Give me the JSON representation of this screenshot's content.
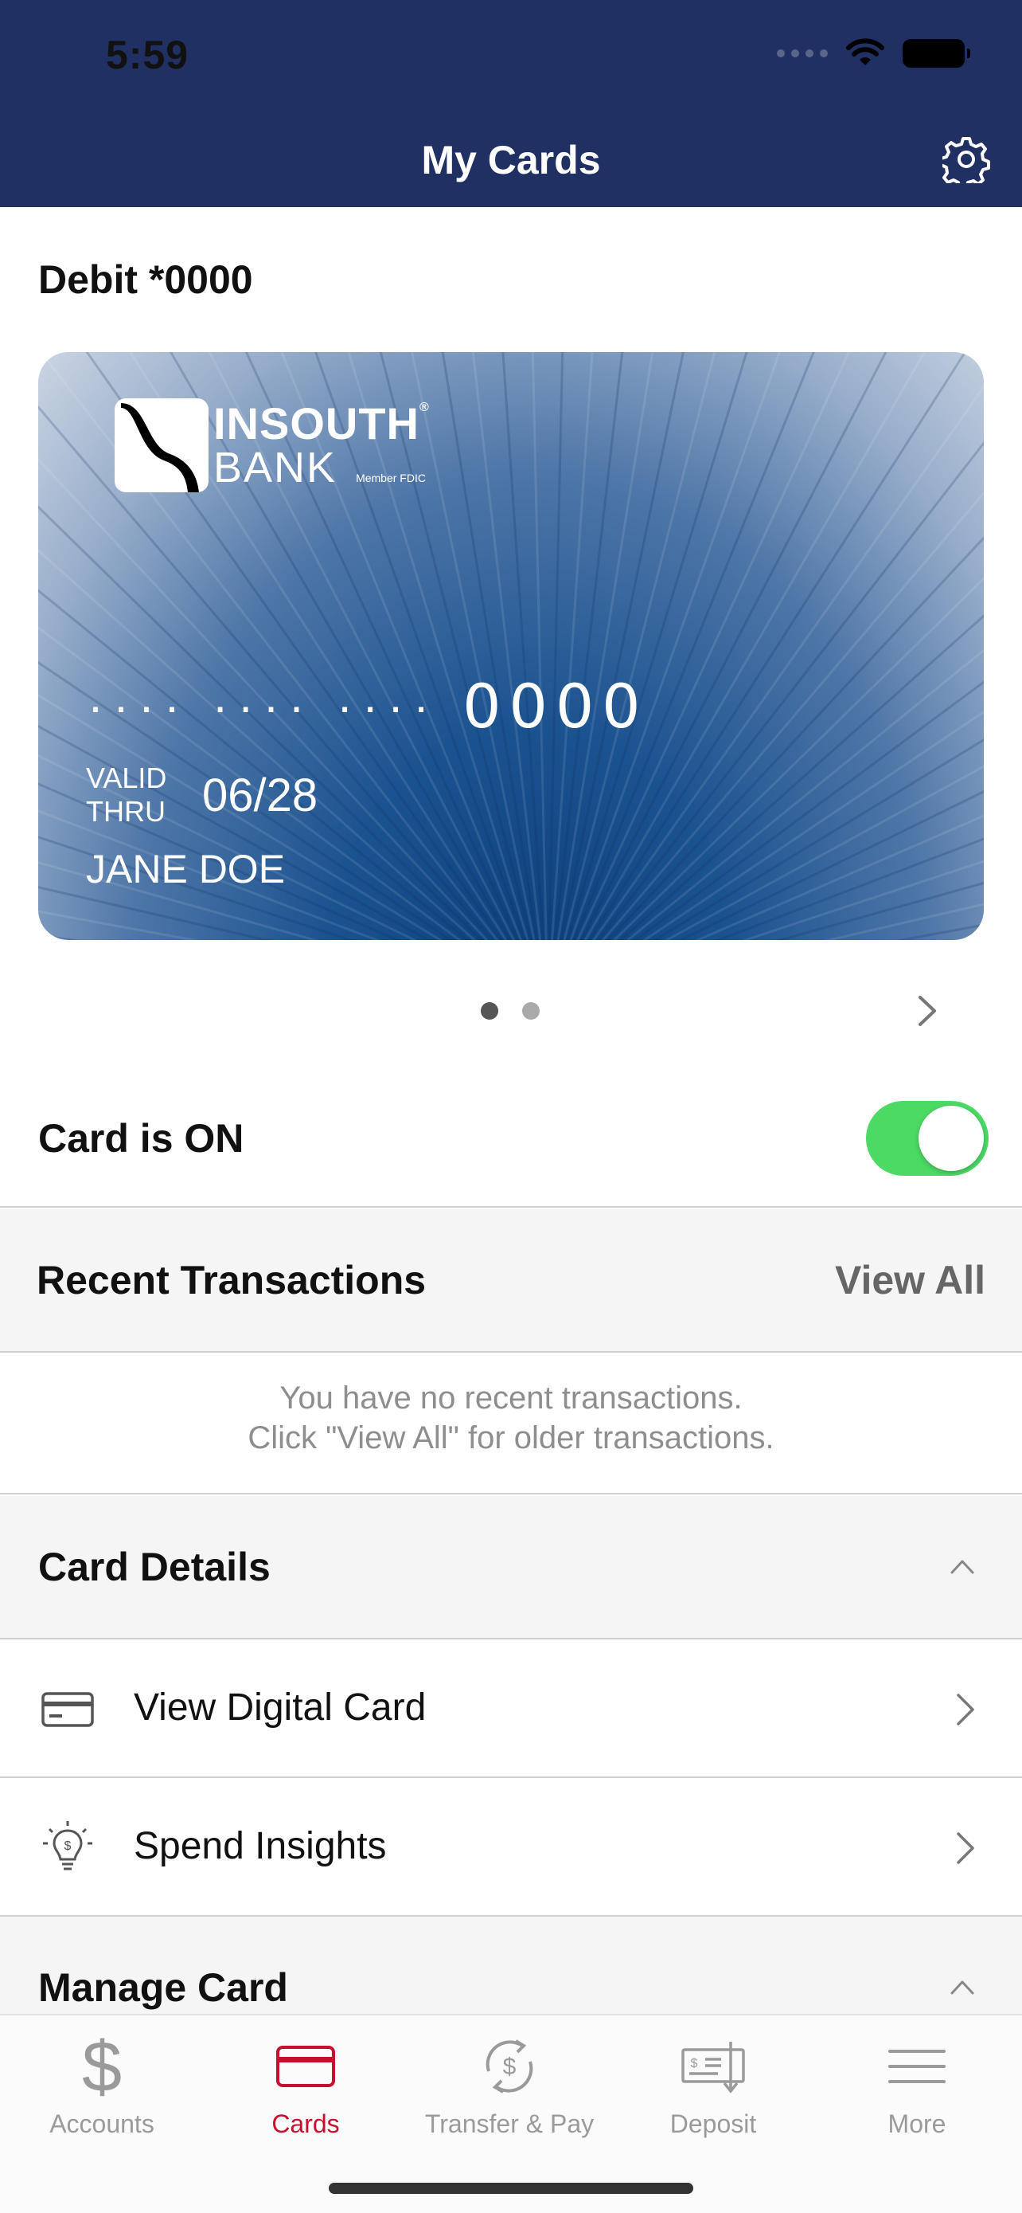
{
  "status_bar": {
    "time": "5:59"
  },
  "header": {
    "title": "My Cards"
  },
  "card": {
    "label": "Debit *0000",
    "bank_name_line1": "INSOUTH",
    "bank_name_line2": "BANK",
    "registered_mark": "®",
    "member_text": "Member FDIC",
    "masked_number": "···· ···· ····",
    "last4": "0000",
    "valid_label_1": "VALID",
    "valid_label_2": "THRU",
    "valid_thru": "06/28",
    "holder": "JANE DOE"
  },
  "card_toggle": {
    "label": "Card is ON",
    "on": true,
    "color": "#4cd964"
  },
  "recent_transactions": {
    "title": "Recent Transactions",
    "view_all": "View All",
    "empty_line1": "You have no recent transactions.",
    "empty_line2": "Click \"View All\" for older transactions."
  },
  "card_details": {
    "title": "Card Details",
    "items": [
      {
        "label": "View Digital Card",
        "icon": "credit-card-icon"
      },
      {
        "label": "Spend Insights",
        "icon": "lightbulb-dollar-icon"
      }
    ]
  },
  "manage_card": {
    "title": "Manage Card"
  },
  "tabbar": {
    "active_color": "#c8102e",
    "items": [
      {
        "label": "Accounts",
        "icon": "dollar-icon",
        "active": false
      },
      {
        "label": "Cards",
        "icon": "card-icon",
        "active": true
      },
      {
        "label": "Transfer & Pay",
        "icon": "transfer-icon",
        "active": false
      },
      {
        "label": "Deposit",
        "icon": "check-deposit-icon",
        "active": false
      },
      {
        "label": "More",
        "icon": "menu-icon",
        "active": false
      }
    ]
  },
  "colors": {
    "header_bg": "#213062"
  }
}
